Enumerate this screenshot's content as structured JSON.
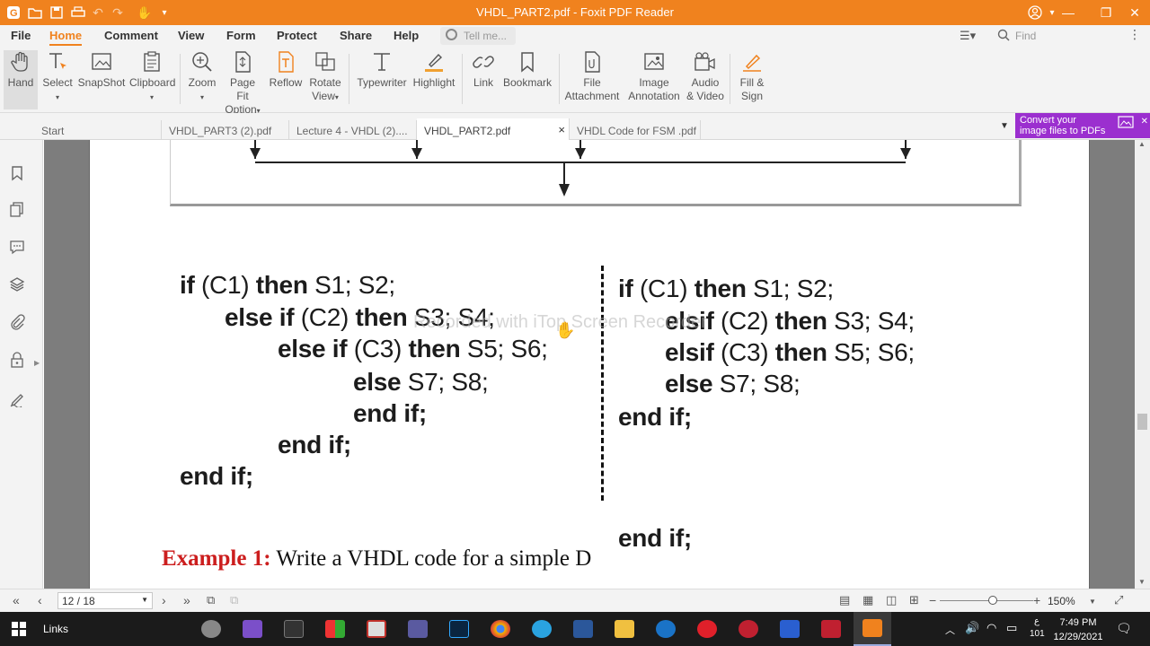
{
  "titlebar": {
    "title": "VHDL_PART2.pdf - Foxit PDF Reader"
  },
  "menu": {
    "items": [
      "File",
      "Home",
      "Comment",
      "View",
      "Form",
      "Protect",
      "Share",
      "Help"
    ],
    "active": "Home",
    "tell_me": "Tell me...",
    "find_placeholder": "Find"
  },
  "ribbon": {
    "hand": "Hand",
    "select": "Select",
    "snapshot": "SnapShot",
    "clipboard": "Clipboard",
    "zoom": "Zoom",
    "page_fit_1": "Page Fit",
    "page_fit_2": "Option",
    "reflow": "Reflow",
    "rotate_1": "Rotate",
    "rotate_2": "View",
    "typewriter": "Typewriter",
    "highlight": "Highlight",
    "link": "Link",
    "bookmark": "Bookmark",
    "file_att_1": "File",
    "file_att_2": "Attachment",
    "image_ann_1": "Image",
    "image_ann_2": "Annotation",
    "audio_1": "Audio",
    "audio_2": "& Video",
    "fill_1": "Fill &",
    "fill_2": "Sign"
  },
  "tabs": {
    "start": "Start",
    "t1": "VHDL_PART3 (2).pdf",
    "t2": "Lecture 4 - VHDL  (2)....",
    "t3": "VHDL_PART2.pdf",
    "t4": "VHDL Code for FSM .pdf",
    "close": "×"
  },
  "promo": {
    "line1": "Convert your",
    "line2": "image files to PDFs"
  },
  "document": {
    "left_code": [
      {
        "kw1": "if",
        "t1": " (C1) ",
        "kw2": "then",
        "t2": " S1; S2;"
      },
      {
        "kw1": "else if",
        "t1": " (C2) ",
        "kw2": "then",
        "t2": " S3; S4;"
      },
      {
        "kw1": "else if",
        "t1": " (C3) ",
        "kw2": "then",
        "t2": " S5; S6;"
      },
      {
        "kw1": "else",
        "t1": " S7; S8;",
        "kw2": "",
        "t2": ""
      },
      {
        "kw1": "end if",
        "t1": ";",
        "kw2": "",
        "t2": ""
      },
      {
        "kw1": "end if",
        "t1": ";",
        "kw2": "",
        "t2": ""
      },
      {
        "kw1": "end if",
        "t1": ";",
        "kw2": "",
        "t2": ""
      }
    ],
    "right_code": [
      {
        "kw1": "if",
        "t1": " (C1) ",
        "kw2": "then",
        "t2": " S1; S2;"
      },
      {
        "kw1": "elsif",
        "t1": " (C2) ",
        "kw2": "then",
        "t2": " S3; S4;"
      },
      {
        "kw1": "elsif",
        "t1": " (C3) ",
        "kw2": "then",
        "t2": " S5; S6;"
      },
      {
        "kw1": "else",
        "t1": " S7; S8;",
        "kw2": "",
        "t2": ""
      },
      {
        "kw1": "end if",
        "t1": ";",
        "kw2": "",
        "t2": ""
      },
      {
        "kw1": "end if",
        "t1": ";",
        "kw2": "",
        "t2": ""
      }
    ],
    "watermark": "Recorded with iTop Screen Recorder",
    "example_label": "Example 1:",
    "example_text": " Write a VHDL code for a simple D"
  },
  "status": {
    "page": "12 / 18",
    "zoom": "150%"
  },
  "taskbar": {
    "links": "Links",
    "lang_1": "ع",
    "lang_2": "101",
    "time": "7:49 PM",
    "date": "12/29/2021"
  },
  "colors": {
    "accent": "#f0821e",
    "promo": "#9b2fcf",
    "example_red": "#cc1e1e"
  }
}
